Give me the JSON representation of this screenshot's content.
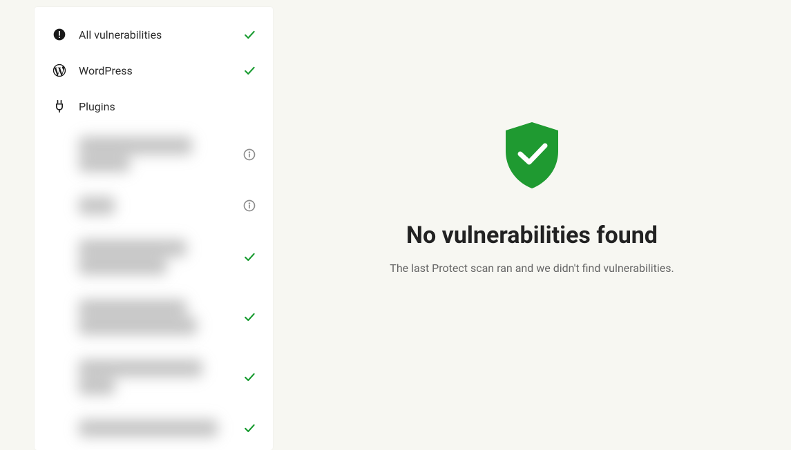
{
  "sidebar": {
    "items": [
      {
        "label": "All vulnerabilities",
        "icon": "alert",
        "status": "check"
      },
      {
        "label": "WordPress",
        "icon": "wordpress",
        "status": "check"
      },
      {
        "label": "Plugins",
        "icon": "plugin",
        "status": "none"
      }
    ],
    "plugins": [
      {
        "blur_lines": [
          "xxxxxxxxxxxxxxxxxxxxxx",
          "xxxxxxxxxx"
        ],
        "status": "info"
      },
      {
        "blur_lines": [
          "xxxxxxx"
        ],
        "status": "info"
      },
      {
        "blur_lines": [
          "xxxxxxxxxxxxxxxxxxxxx",
          "xxxxxxxxxxxxxxxxx"
        ],
        "status": "check"
      },
      {
        "blur_lines": [
          "xxxxxxxxxxxxxxxxxxxxx",
          "xxxxxxxxxxxxxxxxxxxxxxx"
        ],
        "status": "check"
      },
      {
        "blur_lines": [
          "xxxxxxxxxxxxxxxxxxxxxxxx",
          "xxxxxxx"
        ],
        "status": "check"
      },
      {
        "blur_lines": [
          "xxxxxxxxxxxxxxxxxxxxxxxxxxx"
        ],
        "status": "check"
      }
    ]
  },
  "main": {
    "title": "No vulnerabilities found",
    "subtitle": "The last Protect scan ran and we didn't find vulnerabilities."
  }
}
